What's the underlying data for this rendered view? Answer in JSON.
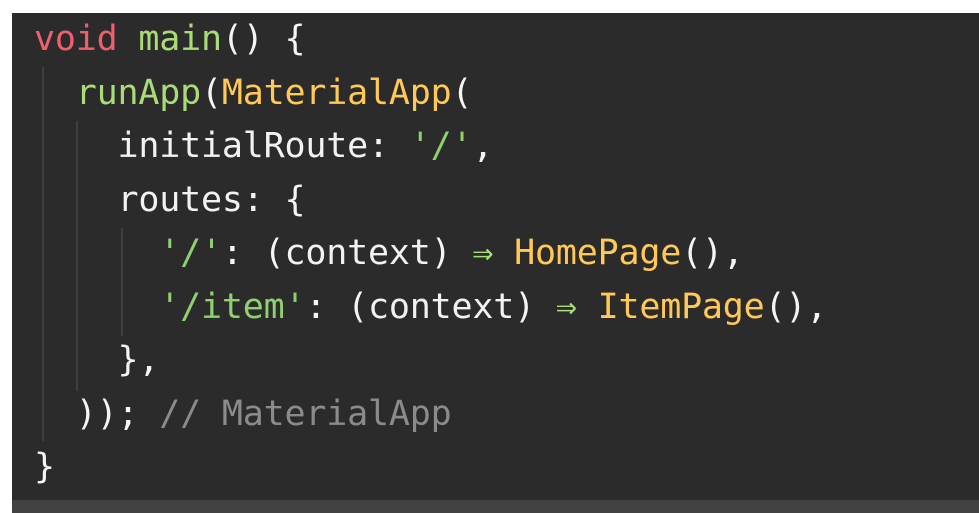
{
  "editor": {
    "colors": {
      "background": "#2b2b2b",
      "keyword": "#f0606c",
      "function": "#a9dc76",
      "class": "#ffc857",
      "string": "#8fd06f",
      "comment": "#8b8b8b",
      "default": "#f2f2f2"
    },
    "lines": [
      [
        {
          "t": "void",
          "c": "kw"
        },
        {
          "t": " ",
          "c": "punc"
        },
        {
          "t": "main",
          "c": "fn"
        },
        {
          "t": "() {",
          "c": "punc"
        }
      ],
      [
        {
          "t": "  ",
          "c": "punc"
        },
        {
          "t": "runApp",
          "c": "fn"
        },
        {
          "t": "(",
          "c": "punc"
        },
        {
          "t": "MaterialApp",
          "c": "cls"
        },
        {
          "t": "(",
          "c": "punc"
        }
      ],
      [
        {
          "t": "    ",
          "c": "punc"
        },
        {
          "t": "initialRoute",
          "c": "prop"
        },
        {
          "t": ": ",
          "c": "punc"
        },
        {
          "t": "'/'",
          "c": "str"
        },
        {
          "t": ",",
          "c": "punc"
        }
      ],
      [
        {
          "t": "    ",
          "c": "punc"
        },
        {
          "t": "routes",
          "c": "prop"
        },
        {
          "t": ": {",
          "c": "punc"
        }
      ],
      [
        {
          "t": "      ",
          "c": "punc"
        },
        {
          "t": "'/'",
          "c": "str"
        },
        {
          "t": ": (",
          "c": "punc"
        },
        {
          "t": "context",
          "c": "prop"
        },
        {
          "t": ") ",
          "c": "punc"
        },
        {
          "t": "⇒",
          "c": "op"
        },
        {
          "t": " ",
          "c": "punc"
        },
        {
          "t": "HomePage",
          "c": "cls"
        },
        {
          "t": "(),",
          "c": "punc"
        }
      ],
      [
        {
          "t": "      ",
          "c": "punc"
        },
        {
          "t": "'/item'",
          "c": "str"
        },
        {
          "t": ": (",
          "c": "punc"
        },
        {
          "t": "context",
          "c": "prop"
        },
        {
          "t": ") ",
          "c": "punc"
        },
        {
          "t": "⇒",
          "c": "op"
        },
        {
          "t": " ",
          "c": "punc"
        },
        {
          "t": "ItemPage",
          "c": "cls"
        },
        {
          "t": "(),",
          "c": "punc"
        }
      ],
      [
        {
          "t": "    ",
          "c": "punc"
        },
        {
          "t": "},",
          "c": "punc"
        }
      ],
      [
        {
          "t": "  ",
          "c": "punc"
        },
        {
          "t": "));",
          "c": "punc"
        },
        {
          "t": " ",
          "c": "punc"
        },
        {
          "t": "// MaterialApp",
          "c": "comment"
        }
      ],
      [
        {
          "t": "}",
          "c": "punc"
        }
      ]
    ]
  }
}
